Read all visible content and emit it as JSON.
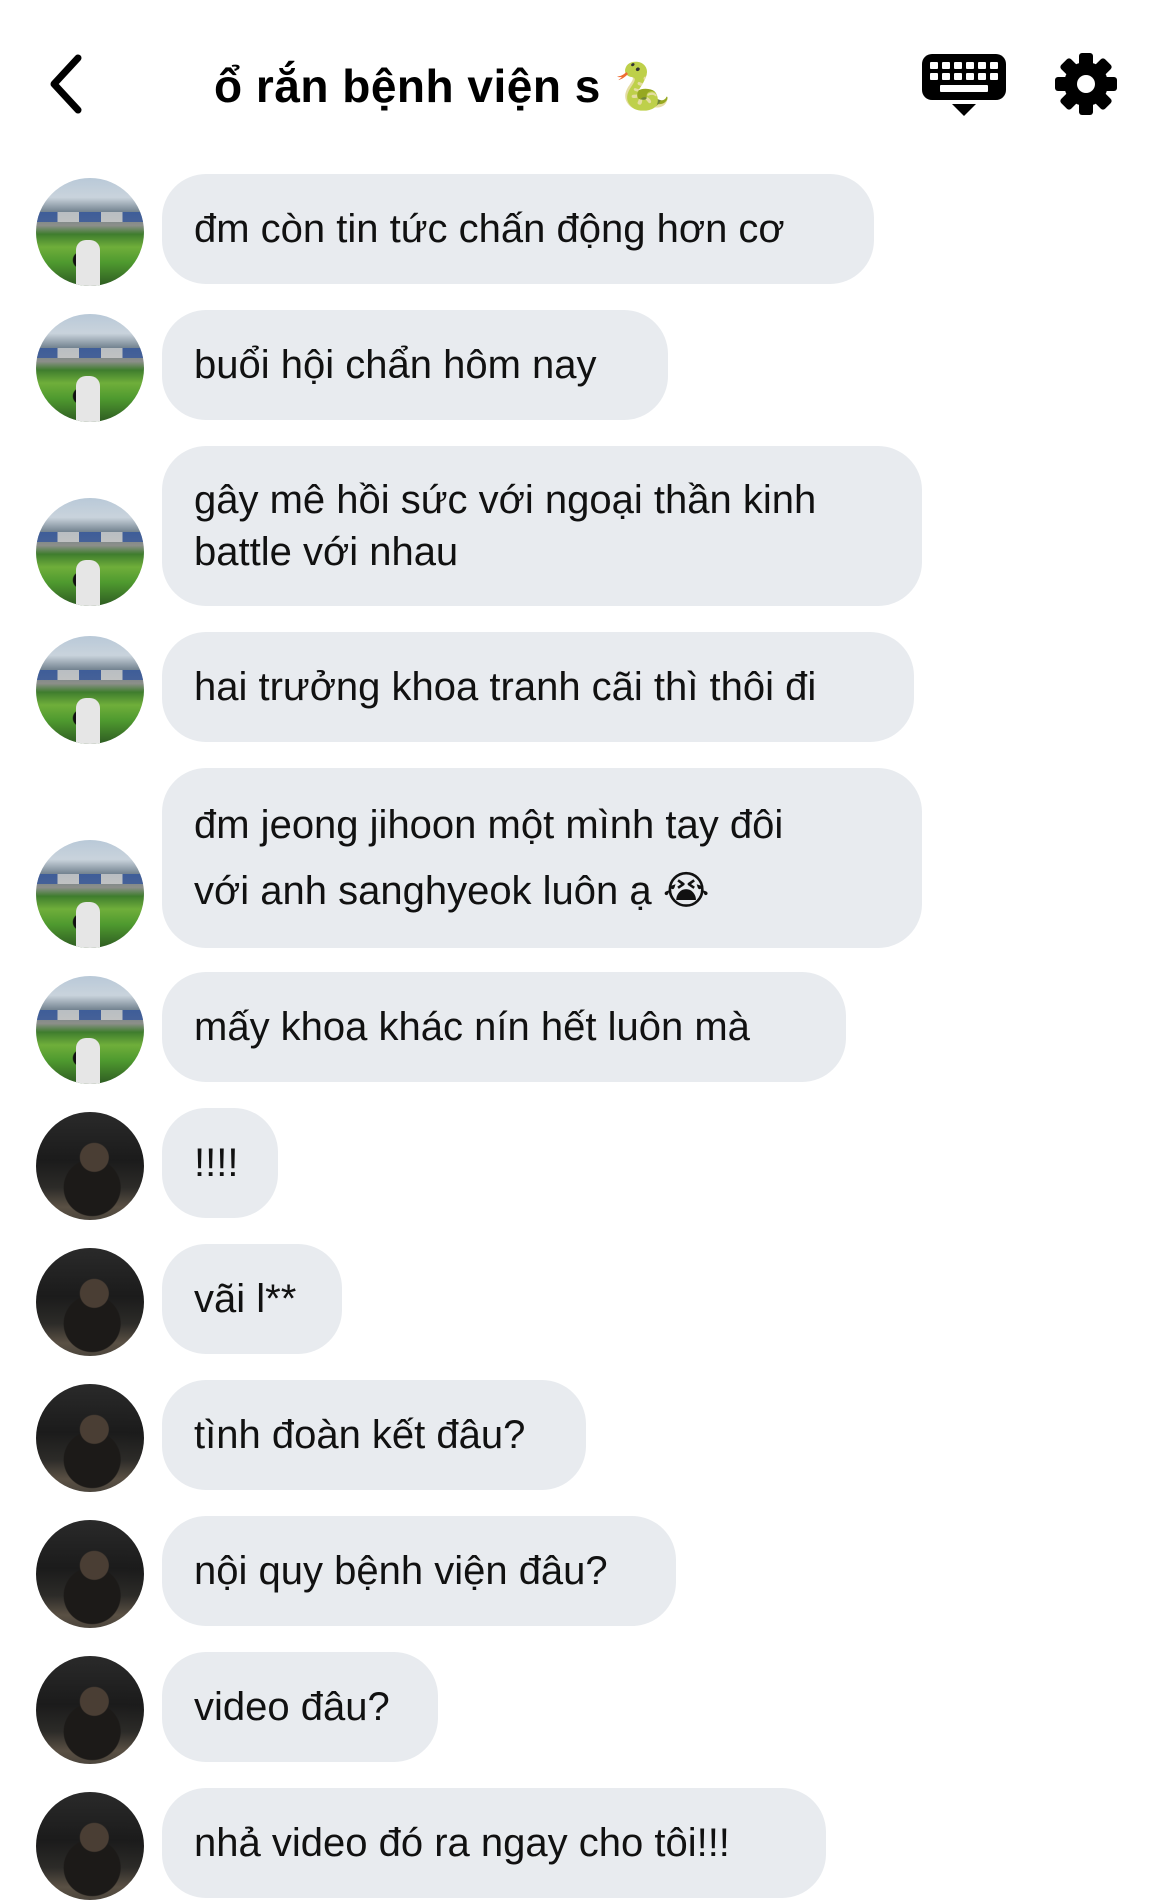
{
  "header": {
    "title": "ổ rắn bệnh viện s 🐍",
    "back_icon": "chevron-left-icon",
    "keyboard_icon": "keyboard-icon",
    "settings_icon": "gear-icon"
  },
  "messages": [
    {
      "sender": "stadium",
      "text": "đm còn tin tức chấn động hơn cơ"
    },
    {
      "sender": "stadium",
      "text": "buổi hội chẩn hôm nay"
    },
    {
      "sender": "stadium",
      "text": "gây mê hồi sức với ngoại thần kinh\nbattle với nhau"
    },
    {
      "sender": "stadium",
      "text": "hai trưởng khoa tranh cãi thì thôi đi"
    },
    {
      "sender": "stadium",
      "text": "đm jeong jihoon một mình tay đôi\nvới anh sanghyeok luôn ạ 😭"
    },
    {
      "sender": "stadium",
      "text": "mấy khoa khác nín hết luôn mà"
    },
    {
      "sender": "dark",
      "text": "!!!!"
    },
    {
      "sender": "dark",
      "text": "vãi l**"
    },
    {
      "sender": "dark",
      "text": "tình đoàn kết đâu?"
    },
    {
      "sender": "dark",
      "text": "nội quy bệnh viện đâu?"
    },
    {
      "sender": "dark",
      "text": "video đâu?"
    },
    {
      "sender": "dark",
      "text": "nhả video đó ra ngay cho tôi!!!"
    }
  ],
  "colors": {
    "bubble": "#e8ebef",
    "text": "#111111",
    "background": "#ffffff"
  }
}
